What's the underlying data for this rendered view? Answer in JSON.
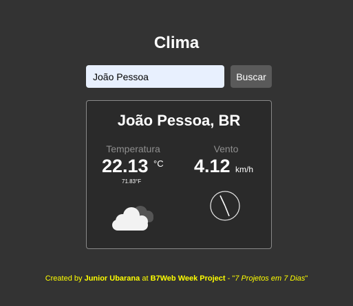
{
  "page": {
    "title": "Clima"
  },
  "search": {
    "value": "João Pessoa",
    "button_label": "Buscar"
  },
  "result": {
    "city": "João Pessoa, BR",
    "temperature_label": "Temperatura",
    "temperature_value": "22.13",
    "temperature_unit": "°C",
    "temperature_f": "71.83°F",
    "wind_label": "Vento",
    "wind_value": "4.12",
    "wind_unit": "km/h",
    "weather_icon": "cloud-icon",
    "wind_icon": "wind-direction-gauge"
  },
  "footer": {
    "prefix": "Created by ",
    "author": "Junior Ubarana",
    "middle": " at ",
    "project": "B7Web Week Project",
    "dash": " - \"",
    "tagline": "7 Projetos em 7 Dias",
    "close_quote": "\""
  },
  "colors": {
    "background": "#333333",
    "card": "#2a2a2a",
    "footer_text": "#ffff00",
    "input_bg": "#e8f0fe"
  }
}
